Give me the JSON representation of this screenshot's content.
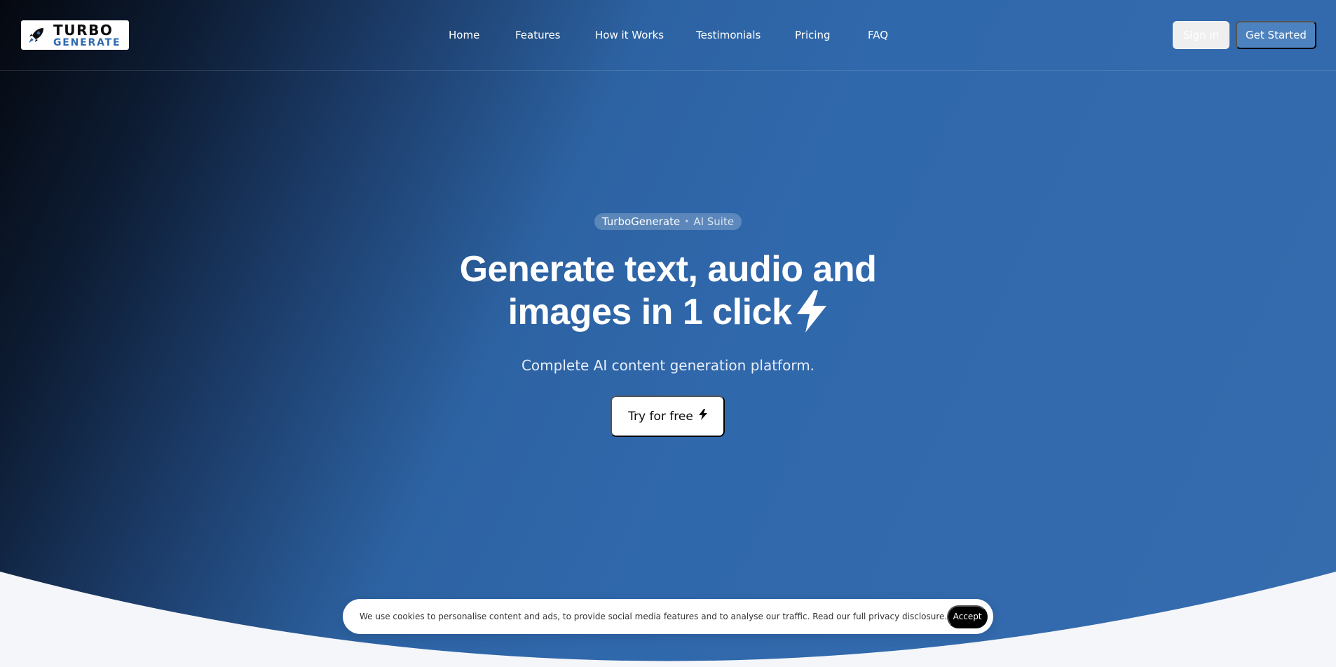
{
  "brand": {
    "name_top": "TURBO",
    "name_bottom": "GENERATE",
    "accent_color": "#2f6bb0"
  },
  "nav": {
    "items": [
      {
        "label": "Home"
      },
      {
        "label": "Features"
      },
      {
        "label": "How it Works"
      },
      {
        "label": "Testimonials"
      },
      {
        "label": "Pricing"
      },
      {
        "label": "FAQ"
      }
    ]
  },
  "header_actions": {
    "sign_in": "Sign In",
    "get_started": "Get Started"
  },
  "hero": {
    "pill_name": "TurboGenerate",
    "pill_separator": "•",
    "pill_tag": "AI Suite",
    "headline_line1": "Generate text, audio and",
    "headline_line2": "images in 1 click",
    "headline_icon": "lightning-bolt-icon",
    "subtitle": "Complete AI content generation platform.",
    "cta_label": "Try for free",
    "cta_icon": "lightning-bolt-icon"
  },
  "cookie_banner": {
    "text": "We use cookies to personalise content and ads, to provide social media features and to analyse our traffic. Read our full privacy disclosure.",
    "accept_label": "Accept"
  },
  "colors": {
    "hero_dark": "#05080f",
    "hero_blue": "#3068ac",
    "page_background": "#f5f6fa",
    "get_started_bg": "#4d82c0"
  }
}
